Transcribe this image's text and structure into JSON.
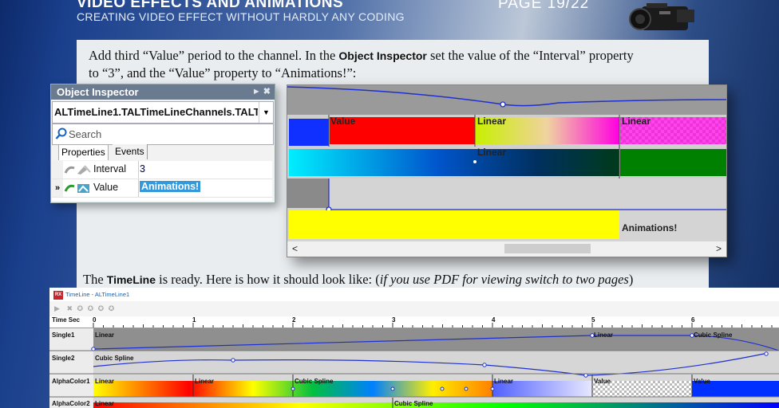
{
  "header": {
    "title": "VIDEO EFFECTS AND ANIMATIONS",
    "subtitle": "CREATING VIDEO EFFECT WITHOUT HARDLY ANY CODING",
    "page": "PAGE 19/22"
  },
  "para1": {
    "t1": "Add third “Value” period to the channel. In the ",
    "b1": "Object Inspector",
    "t2": " set the value of the “Interval” property",
    "t3": "to “3”, and the “Value” property to “Animations!”:"
  },
  "inspector": {
    "title": "Object Inspector",
    "combo": "ALTimeLine1.TALTimeLineChannels.TALTimeLineChannel",
    "search_placeholder": "Search",
    "tabs": [
      "Properties",
      "Events"
    ],
    "rows": [
      {
        "gutter": "",
        "name": "Interval",
        "value": "3"
      },
      {
        "gutter": "»",
        "name": "Value",
        "value": "Animations!"
      }
    ]
  },
  "timeline_zoom": {
    "labels": {
      "value": "Value",
      "linear1": "Linear",
      "linear2": "Linear",
      "linear3": "Linear",
      "animations": "Animations!"
    },
    "scroll_left": "<",
    "scroll_right": ">"
  },
  "para2": {
    "t1": "The ",
    "b1": "TimeLine",
    "t2": " is ready. Here is how it should look like: (",
    "i1": "if you use PDF for viewing switch to two pages",
    "t3": ")"
  },
  "timeline_window": {
    "title": "TimeLine - ALTimeLine1",
    "app_badge": "RX",
    "toolbar_icons": [
      "play-icon",
      "stop-icon",
      "move-up-icon",
      "move-down-icon",
      "move-left-icon",
      "move-right-icon"
    ],
    "ruler_label": "Time Sec",
    "ruler_ticks": [
      "0",
      "1",
      "2",
      "3",
      "4",
      "5",
      "6"
    ],
    "rows": [
      {
        "label": "Single1",
        "segments": [
          "Linear",
          "Linear",
          "Cubic Spline"
        ]
      },
      {
        "label": "Single2",
        "segments": [
          "Cubic Spline"
        ]
      },
      {
        "label": "AlphaColor1",
        "segments": [
          "Linear",
          "Linear",
          "Cubic Spline",
          "Linear",
          "Value",
          "Value"
        ]
      },
      {
        "label": "AlphaColor2",
        "segments": [
          "Linear",
          "Cubic Spline"
        ]
      }
    ]
  },
  "colors": {
    "accent": "#3399dd",
    "inspector_title": "#6a7b90",
    "curve": "#1f2fd0"
  }
}
